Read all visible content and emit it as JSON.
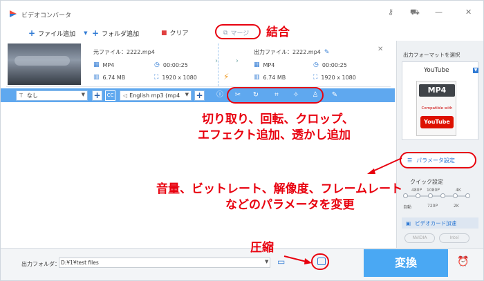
{
  "app": {
    "title": "ビデオコンバータ"
  },
  "toolbar": {
    "add_file": "ファイル追加",
    "add_folder": "フォルダ追加",
    "clear": "クリア",
    "merge": "マージ"
  },
  "file": {
    "source_label": "元ファイル：2222.mp4",
    "source_format": "MP4",
    "source_duration": "00:00:25",
    "source_size": "6.74 MB",
    "source_resolution": "1920 x 1080",
    "output_label": "出力ファイル：2222.mp4",
    "output_format": "MP4",
    "output_duration": "00:00:25",
    "output_size": "6.74 MB",
    "output_resolution": "1920 x 1080"
  },
  "edit_bar": {
    "subtitle_select": "なし",
    "cc_label": "CC",
    "audio_select": "English mp3 (mp4"
  },
  "right_panel": {
    "title": "出力フォーマットを選択",
    "format_name": "YouTube",
    "card_top": "MP4",
    "card_compat": "Compatible with",
    "card_brand": "YouTube",
    "param_button": "パラメータ設定",
    "quick_label": "クイック設定",
    "quick_ticks_top": [
      "480P",
      "1080P",
      "4K"
    ],
    "quick_ticks_bottom": [
      "自動",
      "720P",
      "2K"
    ],
    "gpu_button": "ビデオカード加速",
    "gpu_chips": [
      "NVIDIA",
      "Intel"
    ]
  },
  "bottom": {
    "output_label": "出力フォルダ：",
    "output_path": "D:¥1¥test files",
    "convert_button": "変換"
  },
  "annotations": {
    "merge": "結合",
    "edit_line1": "切り取り、回転、クロップ、",
    "edit_line2": "エフェクト追加、透かし追加",
    "params_line1": "音量、ビットレート、解像度、フレームレート",
    "params_line2": "などのパラメータを変更",
    "compress": "圧縮"
  },
  "colors": {
    "accent": "#4aa8f3",
    "annotation": "#e8000e"
  }
}
